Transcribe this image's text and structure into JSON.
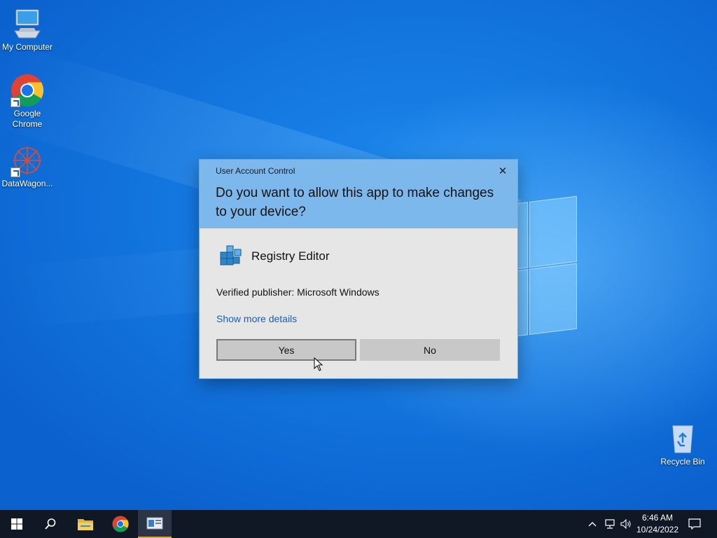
{
  "desktop": {
    "icons": [
      {
        "label": "My Computer"
      },
      {
        "label": "Google Chrome"
      },
      {
        "label": "DataWagon..."
      },
      {
        "label": "Recycle Bin"
      }
    ]
  },
  "uac": {
    "title": "User Account Control",
    "close_icon": "close-icon",
    "question": "Do you want to allow this app to make changes to your device?",
    "app_name": "Registry Editor",
    "publisher": "Verified publisher: Microsoft Windows",
    "details_link": "Show more details",
    "yes_label": "Yes",
    "no_label": "No"
  },
  "taskbar": {
    "items": [
      "start-icon",
      "search-icon",
      "file-explorer-icon",
      "chrome-icon",
      "active-app-icon"
    ],
    "tray": [
      "chevron-up-icon",
      "network-icon",
      "volume-icon",
      "notifications-icon"
    ],
    "time": "6:46 AM",
    "date": "10/24/2022"
  },
  "colors": {
    "accent": "#7db8ec",
    "link": "#1060c0",
    "taskbar": "#101725",
    "desktop": "#1a7be0"
  }
}
